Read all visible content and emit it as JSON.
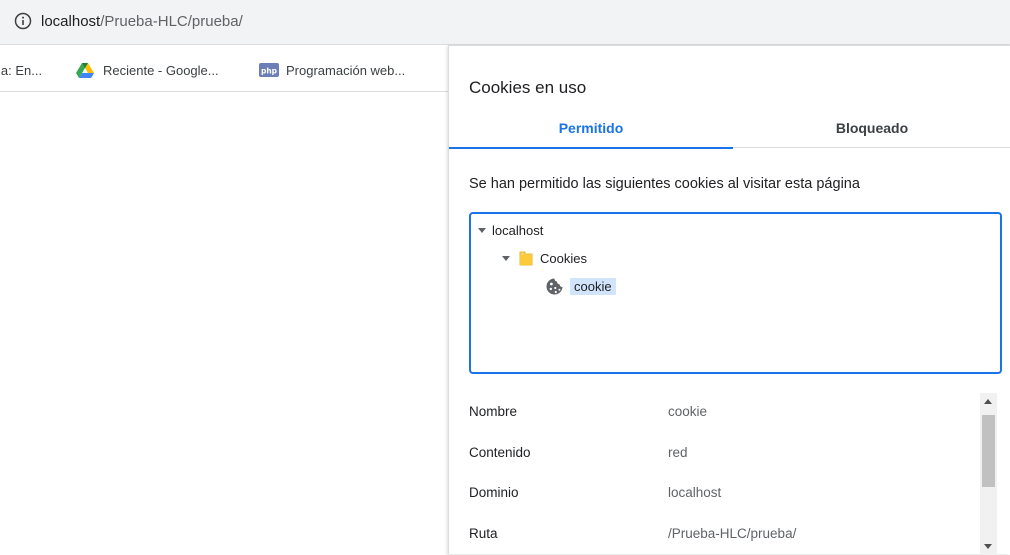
{
  "address_bar": {
    "host": "localhost",
    "path": "/Prueba-HLC/prueba/"
  },
  "bookmarks": [
    {
      "label": "la: En...",
      "icon": "none"
    },
    {
      "label": "Reciente - Google...",
      "icon": "google-drive-icon"
    },
    {
      "label": "Programación web...",
      "icon": "php-icon"
    }
  ],
  "php_badge": "php",
  "panel": {
    "title": "Cookies en uso",
    "tabs": [
      {
        "label": "Permitido",
        "active": true
      },
      {
        "label": "Bloqueado",
        "active": false
      }
    ],
    "description": "Se han permitido las siguientes cookies al visitar esta página",
    "tree": {
      "root": "localhost",
      "folder": "Cookies",
      "item": "cookie"
    },
    "details": [
      {
        "key": "Nombre",
        "value": "cookie"
      },
      {
        "key": "Contenido",
        "value": "red"
      },
      {
        "key": "Dominio",
        "value": "localhost"
      },
      {
        "key": "Ruta",
        "value": "/Prueba-HLC/prueba/"
      }
    ]
  },
  "colors": {
    "accent": "#1a73e8",
    "selection": "#d2e3fc",
    "folder": "#fbc02d"
  }
}
